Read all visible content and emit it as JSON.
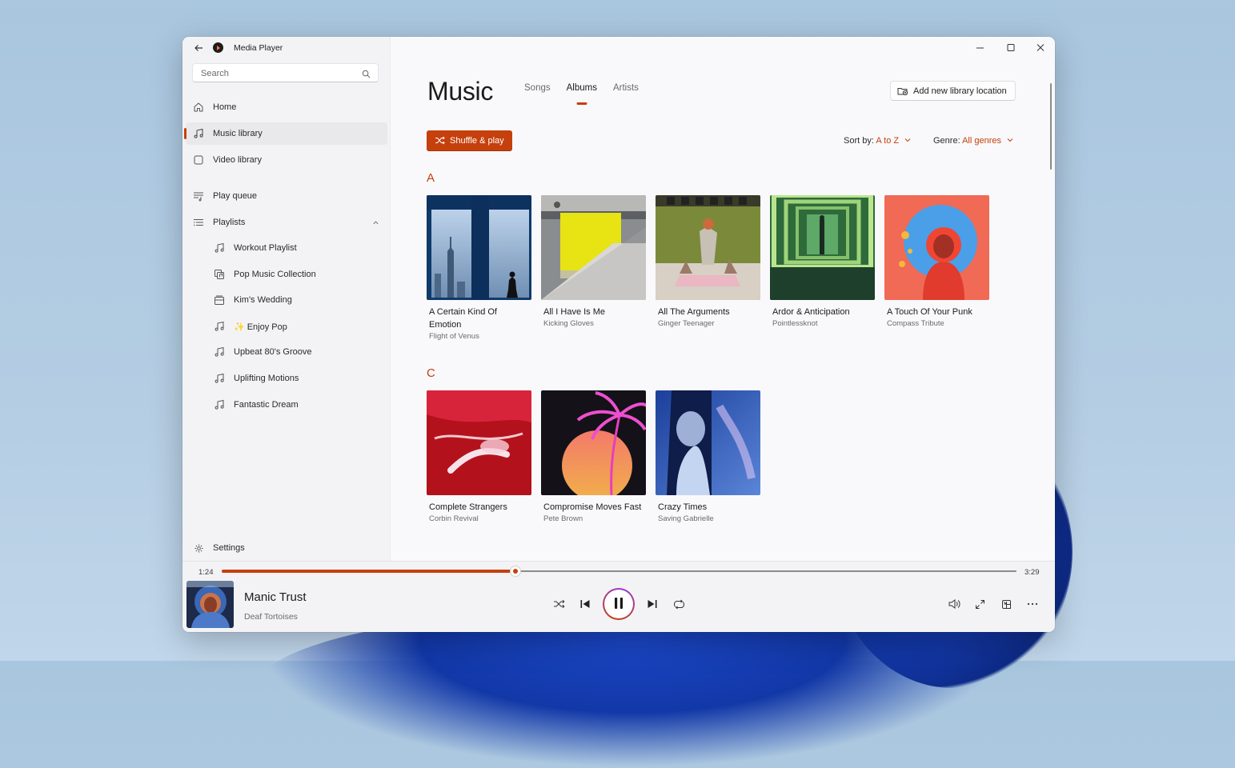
{
  "app": {
    "title": "Media Player"
  },
  "search": {
    "placeholder": "Search"
  },
  "sidebar": {
    "items": [
      {
        "label": "Home",
        "icon": "home-icon"
      },
      {
        "label": "Music library",
        "icon": "music-note-icon",
        "active": true
      },
      {
        "label": "Video library",
        "icon": "video-icon"
      },
      {
        "label": "Play queue",
        "icon": "queue-icon"
      },
      {
        "label": "Playlists",
        "icon": "list-icon"
      }
    ],
    "playlists": [
      {
        "label": "Workout Playlist",
        "icon": "music-note-icon"
      },
      {
        "label": "Pop Music Collection",
        "icon": "media-icon"
      },
      {
        "label": "Kim's Wedding",
        "icon": "album-icon"
      },
      {
        "label": "Enjoy Pop",
        "icon": "music-note-icon",
        "prefix": "✨"
      },
      {
        "label": "Upbeat 80's Groove",
        "icon": "music-note-icon"
      },
      {
        "label": "Uplifting Motions",
        "icon": "music-note-icon"
      },
      {
        "label": "Fantastic Dream",
        "icon": "music-note-icon"
      }
    ],
    "settings_label": "Settings"
  },
  "main": {
    "title": "Music",
    "tabs": [
      {
        "label": "Songs",
        "active": false
      },
      {
        "label": "Albums",
        "active": true
      },
      {
        "label": "Artists",
        "active": false
      }
    ],
    "add_location_label": "Add new library location",
    "shuffle_label": "Shuffle & play",
    "sort_label": "Sort by:",
    "sort_value": "A to Z",
    "genre_label": "Genre:",
    "genre_value": "All genres",
    "sections": [
      {
        "letter": "A",
        "albums": [
          {
            "title": "A Certain Kind Of Emotion",
            "artist": "Flight of Venus"
          },
          {
            "title": "All I Have Is Me",
            "artist": "Kicking Gloves"
          },
          {
            "title": "All The Arguments",
            "artist": "Ginger Teenager"
          },
          {
            "title": "Ardor & Anticipation",
            "artist": "Pointlessknot"
          },
          {
            "title": "A Touch Of Your Punk",
            "artist": "Compass Tribute"
          }
        ]
      },
      {
        "letter": "C",
        "albums": [
          {
            "title": "Complete Strangers",
            "artist": "Corbin Revival"
          },
          {
            "title": "Compromise Moves Fast",
            "artist": "Pete Brown"
          },
          {
            "title": "Crazy Times",
            "artist": "Saving Gabrielle"
          }
        ]
      }
    ]
  },
  "player": {
    "elapsed": "1:24",
    "duration": "3:29",
    "progress": 0.37,
    "track_title": "Manic Trust",
    "track_artist": "Deaf Tortoises"
  },
  "colors": {
    "accent": "#c5400c",
    "background": "#f9f9fb",
    "sidebar": "#f3f3f5"
  }
}
